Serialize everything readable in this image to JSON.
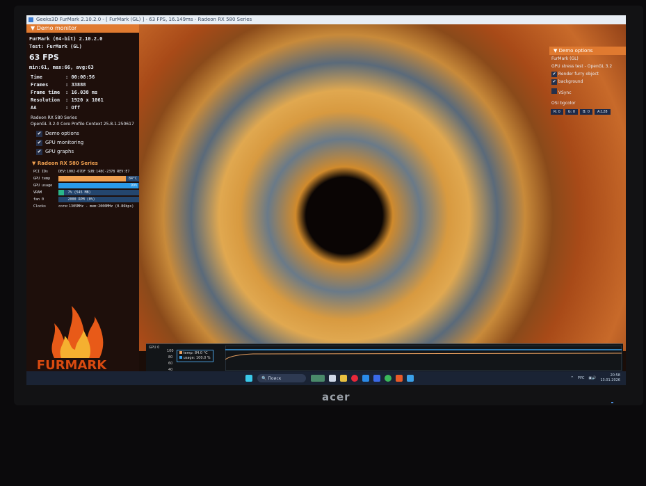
{
  "window_title": "Geeks3D FurMark 2.10.2.0 - [ FurMark (GL) ] - 63 FPS, 16.149ms - Radeon RX 580 Series",
  "demo_monitor": {
    "header": "Demo monitor",
    "app": "FurMark (64-bit) 2.10.2.0",
    "test": "Test: FurMark (GL)",
    "fps": "63 FPS",
    "fps_stats": "min:61, max:66, avg:63",
    "stats": [
      {
        "label": "Time",
        "value": "00:08:56"
      },
      {
        "label": "Frames",
        "value": "33888"
      },
      {
        "label": "Frame time",
        "value": "16.038 ms"
      },
      {
        "label": "Resolution",
        "value": "1920 x 1061"
      },
      {
        "label": "AA",
        "value": "Off"
      }
    ],
    "gpu_name": "Radeon RX 580 Series",
    "gl_context": "OpenGL 3.2.0 Core Profile Context 25.8.1.250617",
    "checkboxes": [
      {
        "label": "Demo options",
        "checked": true
      },
      {
        "label": "GPU monitoring",
        "checked": true
      },
      {
        "label": "GPU graphs",
        "checked": true
      }
    ]
  },
  "gpu_monitor": {
    "header": "Radeon RX 580 Series",
    "pci_label": "PCI IDs",
    "pci_value": "DEV:1002-67DF SUB:148C-2378 REV:E7",
    "temp_label": "GPU temp",
    "temp_value": "84°C",
    "temp_fraction": 0.84,
    "usage_label": "GPU usage",
    "usage_value": "99%",
    "usage_fraction": 0.99,
    "vram_label": "VRAM",
    "vram_value": "7% (545 MB)",
    "vram_fraction": 0.07,
    "fan_label": "fan 0",
    "fan_value": "2000 RPM (0%)",
    "fan_fraction": 0,
    "clocks_label": "Clocks",
    "clocks_value": "core:1305MHz - mem:2000MHz (0.86bps)"
  },
  "demo_options": {
    "header": "Demo options",
    "name": "FurMark (GL)",
    "desc": "GPU stress test - OpenGL 3.2",
    "render_furry": "Render furry object",
    "background": "background",
    "vsync": "VSync",
    "osi_label": "OSI bgcolor",
    "r": "R: 0",
    "g": "G: 0",
    "b": "B: 0",
    "a": "A:128"
  },
  "graph": {
    "title": "GPU 0",
    "y_ticks": [
      "100",
      "80",
      "60",
      "40"
    ],
    "legend_temp": "temp: 84.0 °C",
    "legend_usage": "usage: 100.0 %",
    "temp_color": "#e8a060",
    "usage_color": "#3aa0e8"
  },
  "taskbar": {
    "search": "Поиск",
    "lang": "РУС",
    "time": "20:58",
    "date": "13.01.2026"
  },
  "monitor_brand": "acer"
}
